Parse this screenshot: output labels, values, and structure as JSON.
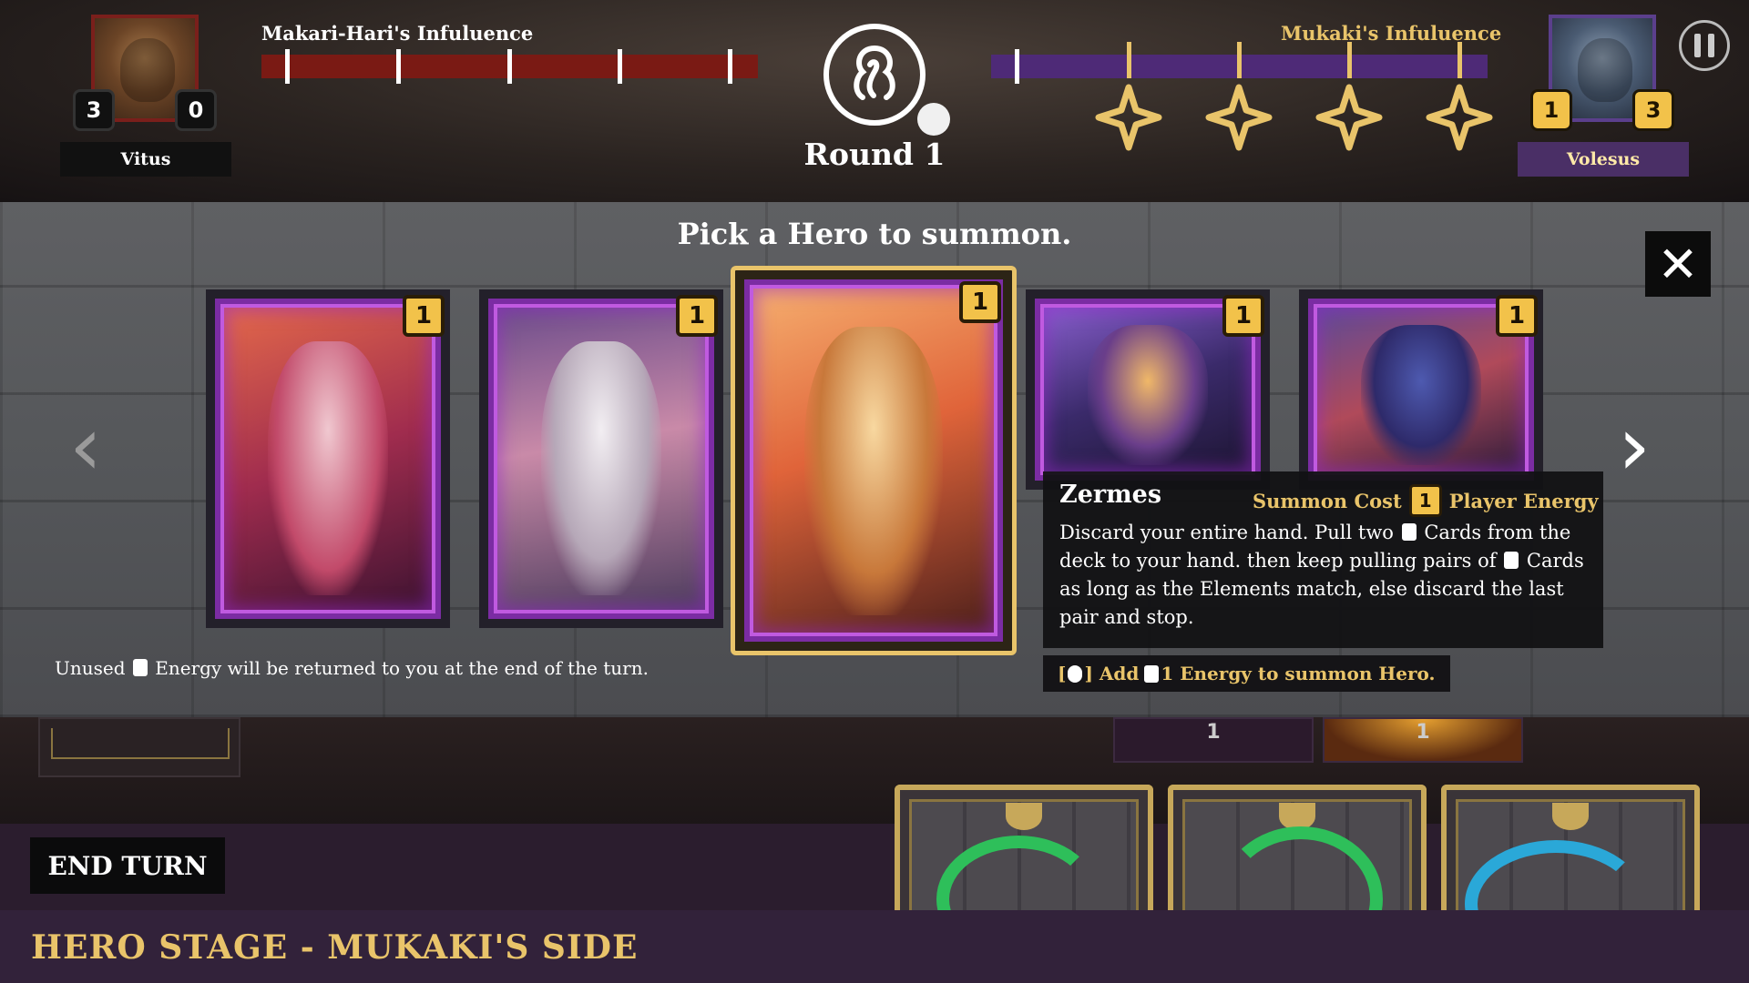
{
  "hud": {
    "left_player": {
      "name": "Vitus",
      "counter_left": "3",
      "counter_right": "0"
    },
    "right_player": {
      "name": "Volesus",
      "counter_left": "1",
      "counter_right": "3"
    },
    "left_influence_label": "Makari-Hari's Infuluence",
    "right_influence_label": "Mukaki's Infuluence",
    "round_label": "Round 1",
    "colors": {
      "left_bar": "#7a1a14",
      "right_bar": "#4e2a77",
      "gold": "#e9c46a"
    }
  },
  "summon": {
    "title": "Pick a Hero to summon.",
    "cards": [
      {
        "name": "hero-card-1",
        "cost": "1",
        "palette": [
          "#d9526a",
          "#7e2a4a"
        ]
      },
      {
        "name": "hero-card-2",
        "cost": "1",
        "palette": [
          "#c8c0c8",
          "#4e3b5c"
        ]
      },
      {
        "name": "hero-card-3",
        "cost": "1",
        "palette": [
          "#f4a060",
          "#7a3018"
        ]
      },
      {
        "name": "hero-card-4",
        "cost": "1",
        "palette": [
          "#a86be0",
          "#2b1f48"
        ]
      },
      {
        "name": "hero-card-5",
        "cost": "1",
        "palette": [
          "#4b3f8a",
          "#a02c3a"
        ]
      }
    ],
    "tooltip": {
      "name": "Zermes",
      "summon_cost_label": "Summon Cost",
      "summon_cost_value": "1",
      "energy_label": "Player Energy",
      "desc_part1": "Discard your entire hand. Pull two",
      "desc_part2": "Cards from the deck to your hand. then keep pulling pairs of",
      "desc_part3": "Cards as long as the Elements match, else discard the last pair and stop."
    },
    "hint_prefix": "[",
    "hint_mid": "] Add",
    "hint_suffix": "1 Energy to summon Hero.",
    "energy_note_prefix": "Unused",
    "energy_note_suffix": "Energy will be returned to you at the end of the turn."
  },
  "board": {
    "enemy_slot_1": "1",
    "enemy_slot_2": "1"
  },
  "footer": {
    "end_turn": "END TURN",
    "stage": "HERO STAGE - MUKAKI'S SIDE"
  }
}
